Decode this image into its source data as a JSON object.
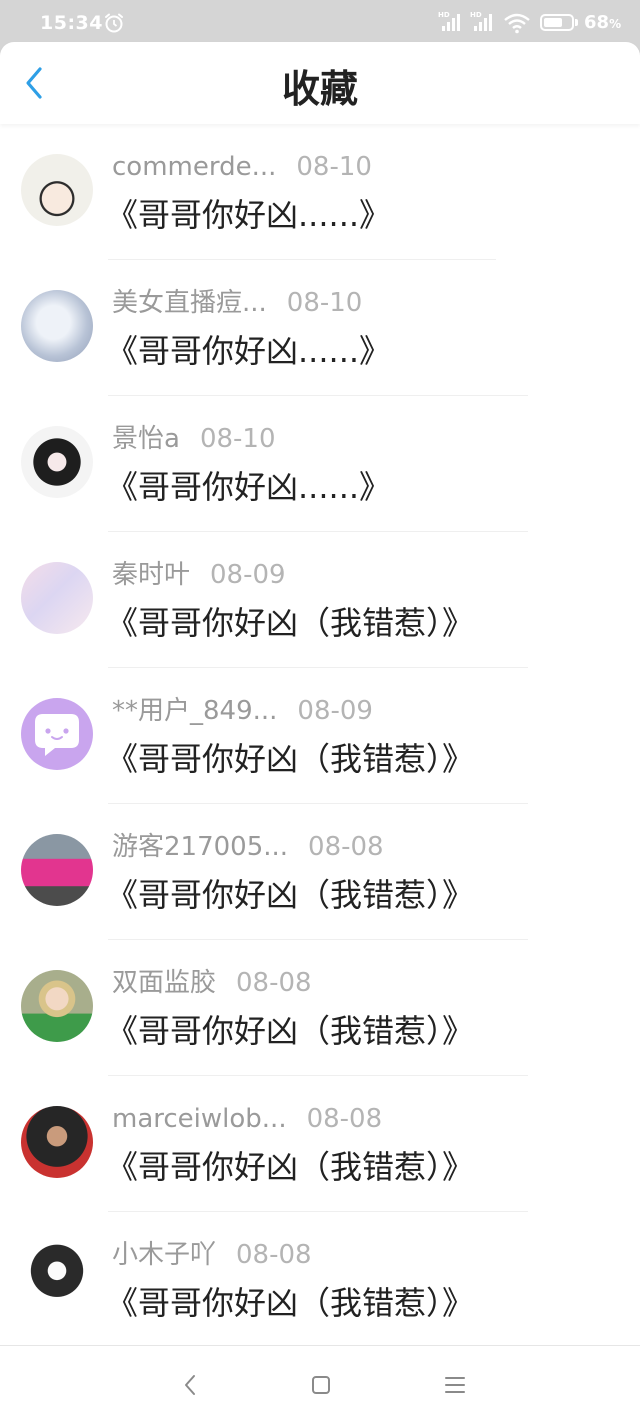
{
  "status_bar": {
    "time": "15:34",
    "network_label": "HD",
    "battery_level": 68,
    "battery_text": "68",
    "battery_unit": "%"
  },
  "header": {
    "title": "收藏"
  },
  "colors": {
    "accent": "#2e9fe6",
    "status_bar_bg": "#d5d5d5",
    "name_text": "#9a9a9a",
    "date_text": "#b4b4b4",
    "title_text": "#222222"
  },
  "items": [
    {
      "name": "commerde...",
      "date": "08-10",
      "title": "《哥哥你好凶......》"
    },
    {
      "name": "美女直播痘...",
      "date": "08-10",
      "title": "《哥哥你好凶......》"
    },
    {
      "name": "景怡a",
      "date": "08-10",
      "title": "《哥哥你好凶......》"
    },
    {
      "name": "秦时叶",
      "date": "08-09",
      "title": "《哥哥你好凶（我错惹）》"
    },
    {
      "name": "**用户_849...",
      "date": "08-09",
      "title": "《哥哥你好凶（我错惹）》"
    },
    {
      "name": "游客217005...",
      "date": "08-08",
      "title": "《哥哥你好凶（我错惹）》"
    },
    {
      "name": "双面监胶",
      "date": "08-08",
      "title": "《哥哥你好凶（我错惹）》"
    },
    {
      "name": "marceiwlob...",
      "date": "08-08",
      "title": "《哥哥你好凶（我错惹）》"
    },
    {
      "name": "小木子吖",
      "date": "08-08",
      "title": "《哥哥你好凶（我错惹）》"
    }
  ],
  "icons": {
    "status": [
      "alarm-icon",
      "signal-icon",
      "wifi-icon",
      "battery-icon"
    ],
    "header_back": "back-chevron-icon",
    "nav": [
      "nav-back-icon",
      "nav-home-icon",
      "nav-menu-icon"
    ]
  }
}
